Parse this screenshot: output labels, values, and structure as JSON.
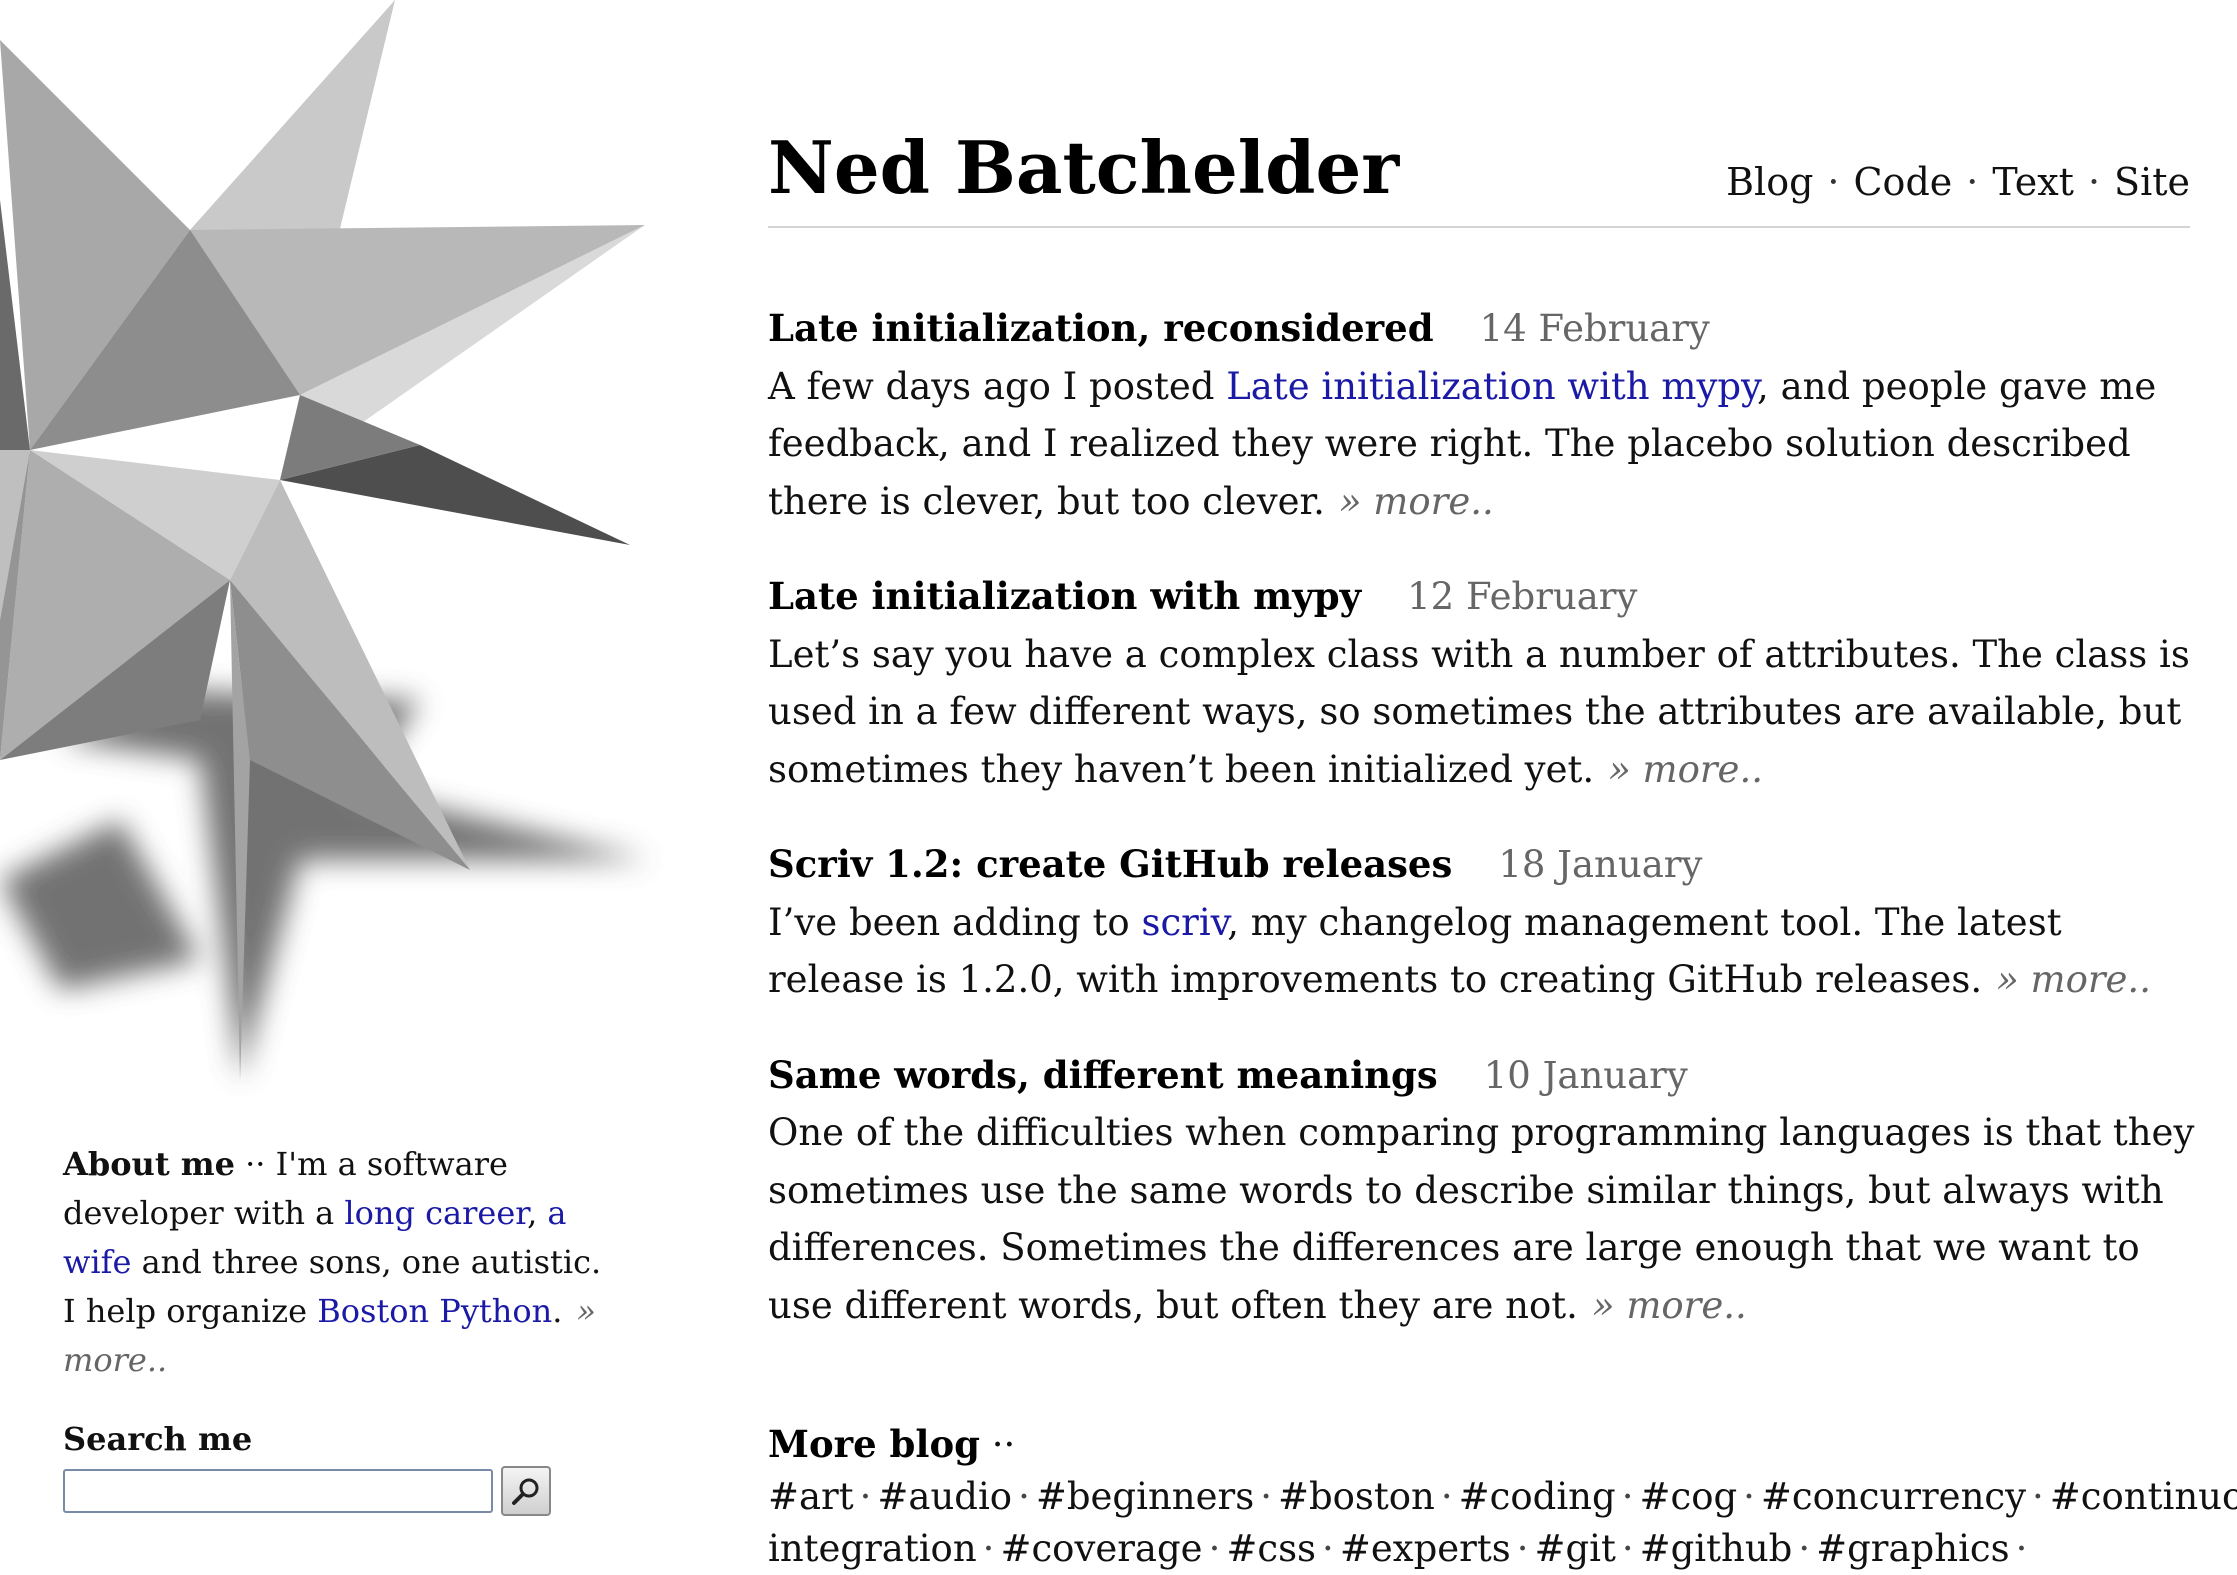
{
  "site": {
    "title": "Ned Batchelder"
  },
  "nav": [
    "Blog",
    "Code",
    "Text",
    "Site"
  ],
  "nav_separator": "·",
  "about": {
    "heading": "About me",
    "sep": " ·· ",
    "text_before": "I'm a software developer with a ",
    "link1": "long career",
    "comma": ", ",
    "link2": "a wife",
    "text_after": " and three sons, one autistic. I help organize ",
    "link3": "Boston Python",
    "period": ".",
    "more": "» more.."
  },
  "search": {
    "heading": "Search me",
    "input_value": "",
    "button_icon": "magnifier-icon"
  },
  "posts": [
    {
      "title": "Late initialization, reconsidered",
      "date": "14 February",
      "body_before": "A few days ago I posted ",
      "link": "Late initialization with mypy",
      "body_after": ", and people gave me feedback, and I realized they were right. The placebo solution described there is clever, but too clever.",
      "more": "» more.."
    },
    {
      "title": "Late initialization with mypy",
      "date": "12 February",
      "body_before": "Let’s say you have a complex class with a number of attributes. The class is used in a few different ways, so sometimes the attributes are available, but sometimes they haven’t been initialized yet.",
      "link": "",
      "body_after": "",
      "more": "» more.."
    },
    {
      "title": "Scriv 1.2: create GitHub releases",
      "date": "18 January",
      "body_before": "I’ve been adding to ",
      "link": "scriv",
      "body_after": ", my changelog management tool. The latest release is 1.2.0, with improvements to creating GitHub releases.",
      "more": "» more.."
    },
    {
      "title": "Same words, different meanings",
      "date": "10 January",
      "body_before": "One of the difficulties when comparing programming languages is that they sometimes use the same words to describe similar things, but always with differences. Sometimes the differences are large enough that we want to use different words, but often they are not.",
      "link": "",
      "body_after": "",
      "more": "» more.."
    }
  ],
  "more_blog": {
    "heading": "More blog",
    "sep": " ·· ",
    "tags": [
      "#art",
      "#audio",
      "#beginners",
      "#boston",
      "#coding",
      "#cog",
      "#concurrency",
      "#continuous-integration",
      "#coverage",
      "#css",
      "#experts",
      "#git",
      "#github",
      "#graphics"
    ]
  },
  "colors": {
    "link": "#1a1aa6",
    "date": "#666666",
    "rule": "#d4d4d4"
  }
}
